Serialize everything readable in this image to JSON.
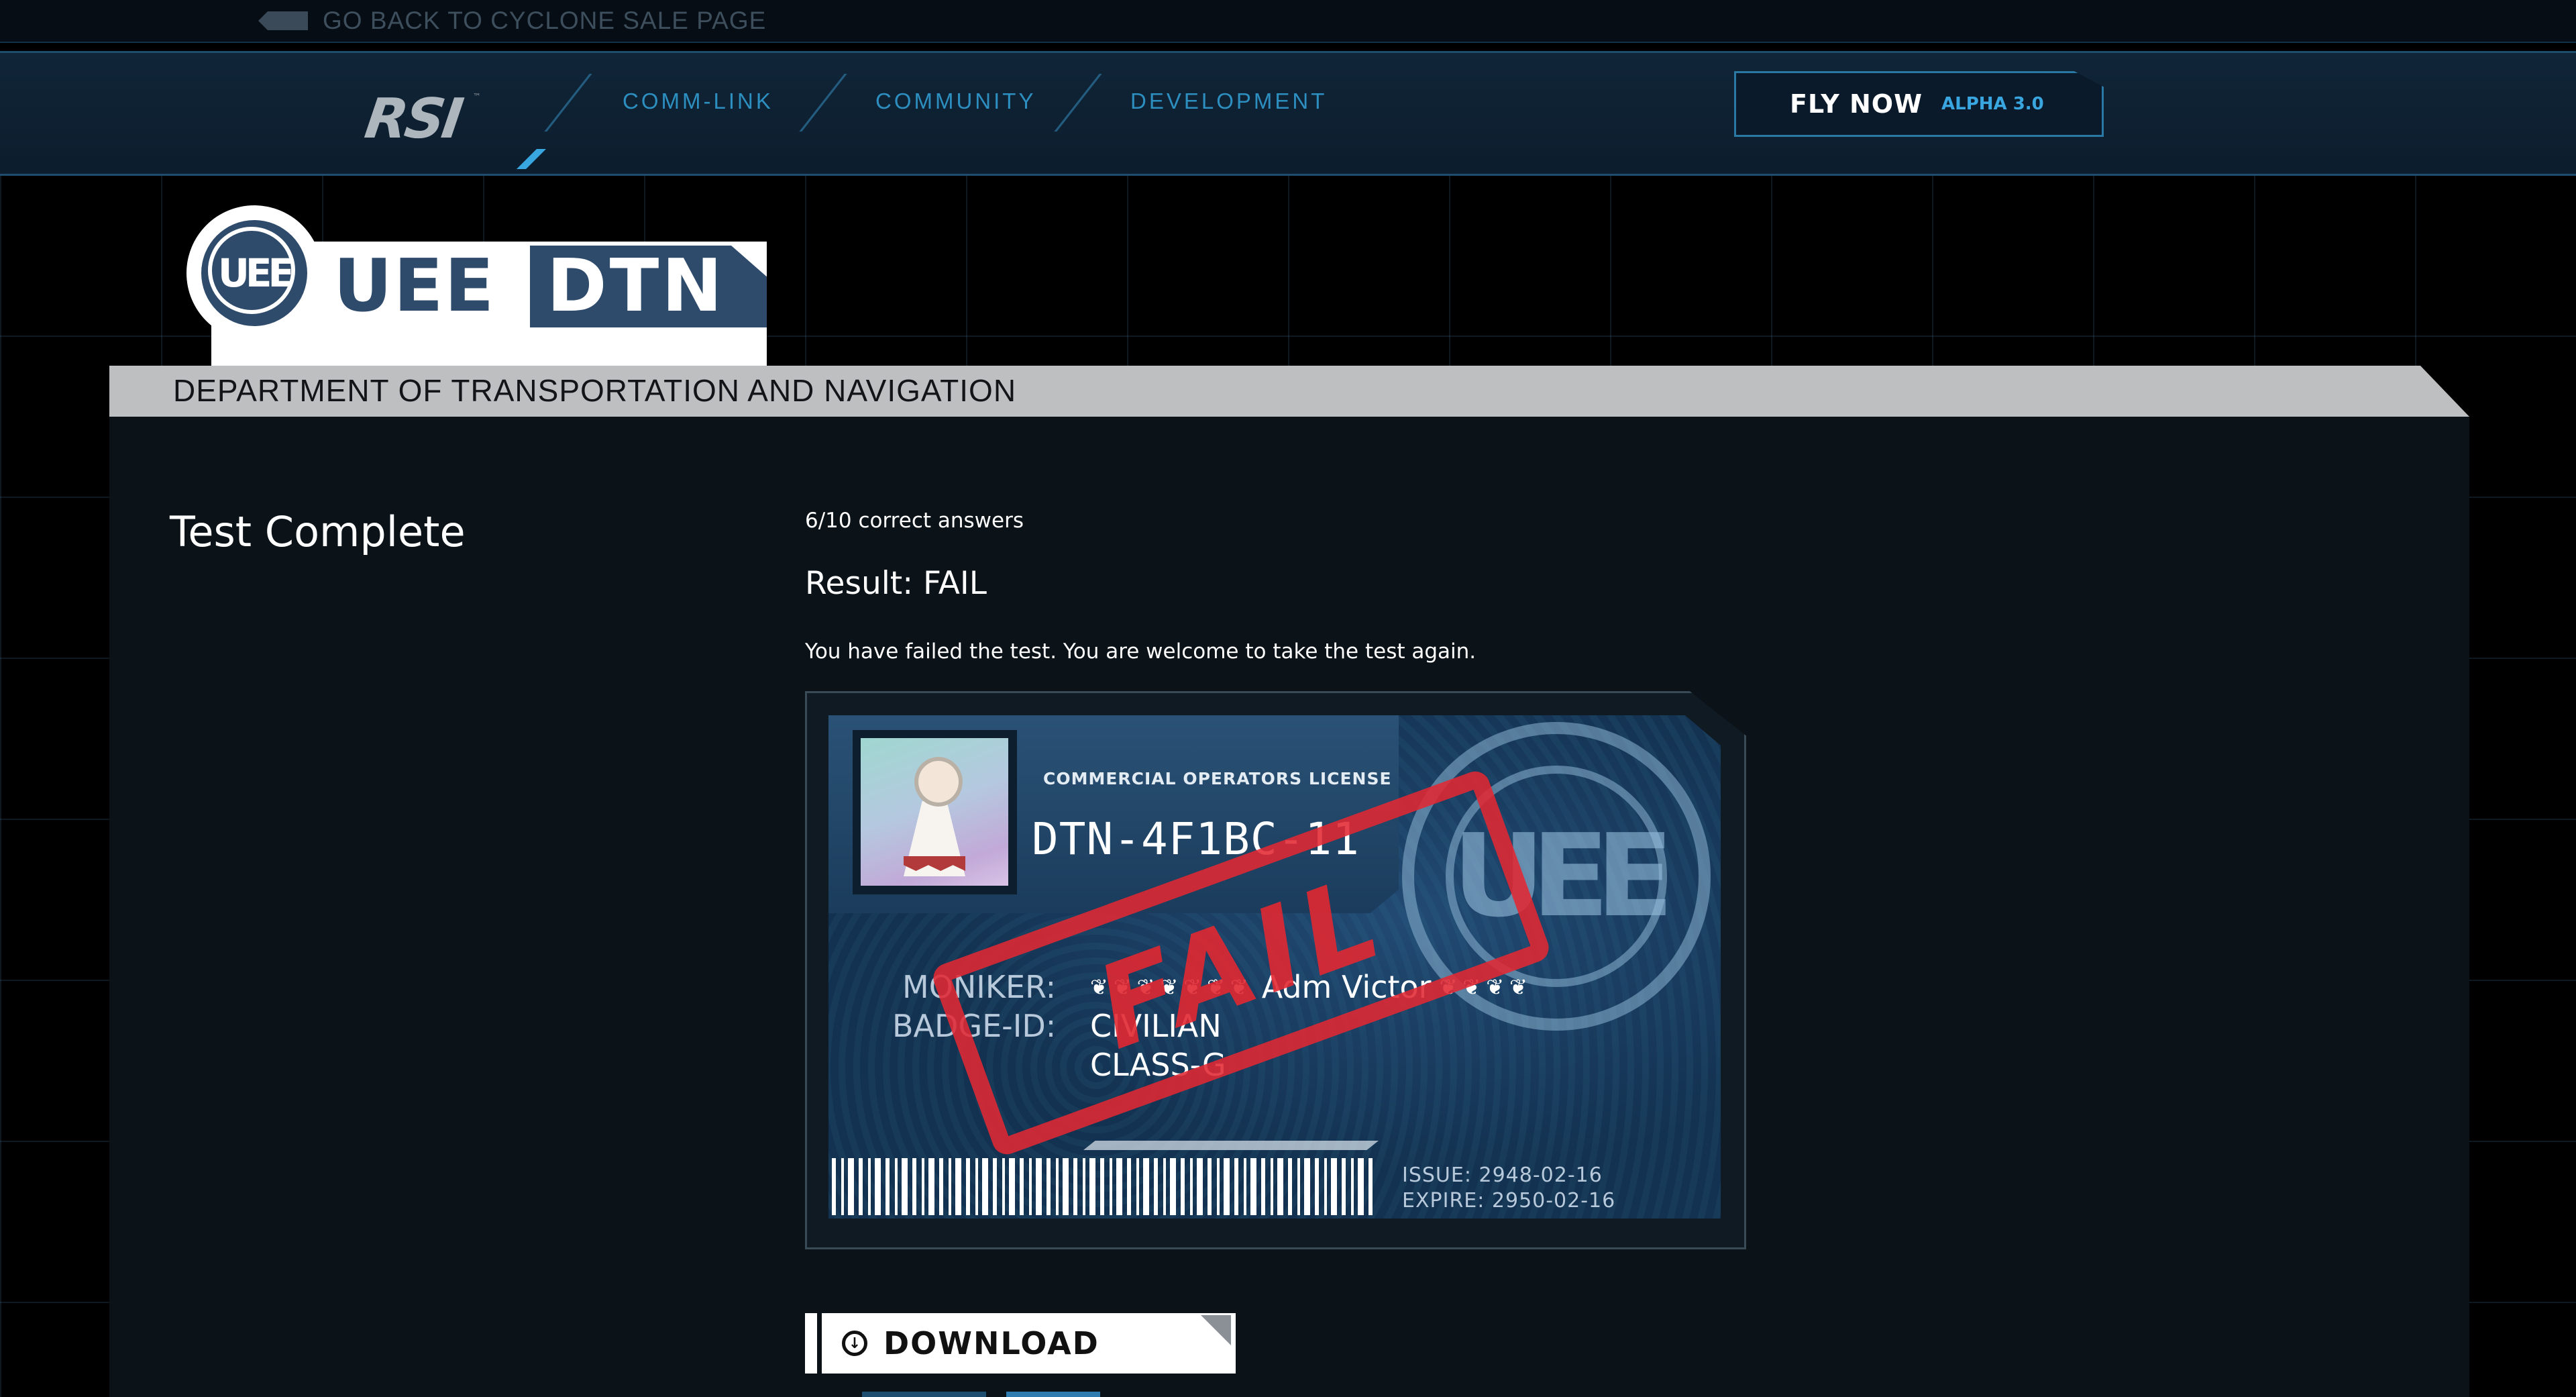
{
  "topbar": {
    "back_label": "GO BACK TO CYCLONE SALE PAGE"
  },
  "nav": {
    "logo": "RSI",
    "items": [
      "COMM-LINK",
      "COMMUNITY",
      "DEVELOPMENT"
    ],
    "fly_now": "FLY NOW",
    "fly_version": "ALPHA 3.0"
  },
  "brand": {
    "uee": "UEE",
    "dtn": "DTN",
    "department": "DEPARTMENT OF TRANSPORTATION AND NAVIGATION"
  },
  "test": {
    "title": "Test Complete",
    "score": "6/10 correct answers",
    "result": "Result: FAIL",
    "message": "You have failed the test. You are welcome to take the test again."
  },
  "license": {
    "type": "COMMERCIAL OPERATORS LICENSE",
    "number": "DTN-4F1BC-11",
    "moniker_label": "MONIKER:",
    "moniker_value": "Adm Victor",
    "badge_label": "BADGE-ID:",
    "badge_line1": "CIVILIAN",
    "badge_line2": "CLASS-G",
    "issue": "ISSUE:  2948-02-16",
    "expire": "EXPIRE: 2950-02-16",
    "stamp": "FAIL"
  },
  "download": {
    "label": "DOWNLOAD"
  },
  "colors": {
    "accent": "#2d8fc0",
    "stamp": "#e12832",
    "brand": "#2f4b6c"
  }
}
